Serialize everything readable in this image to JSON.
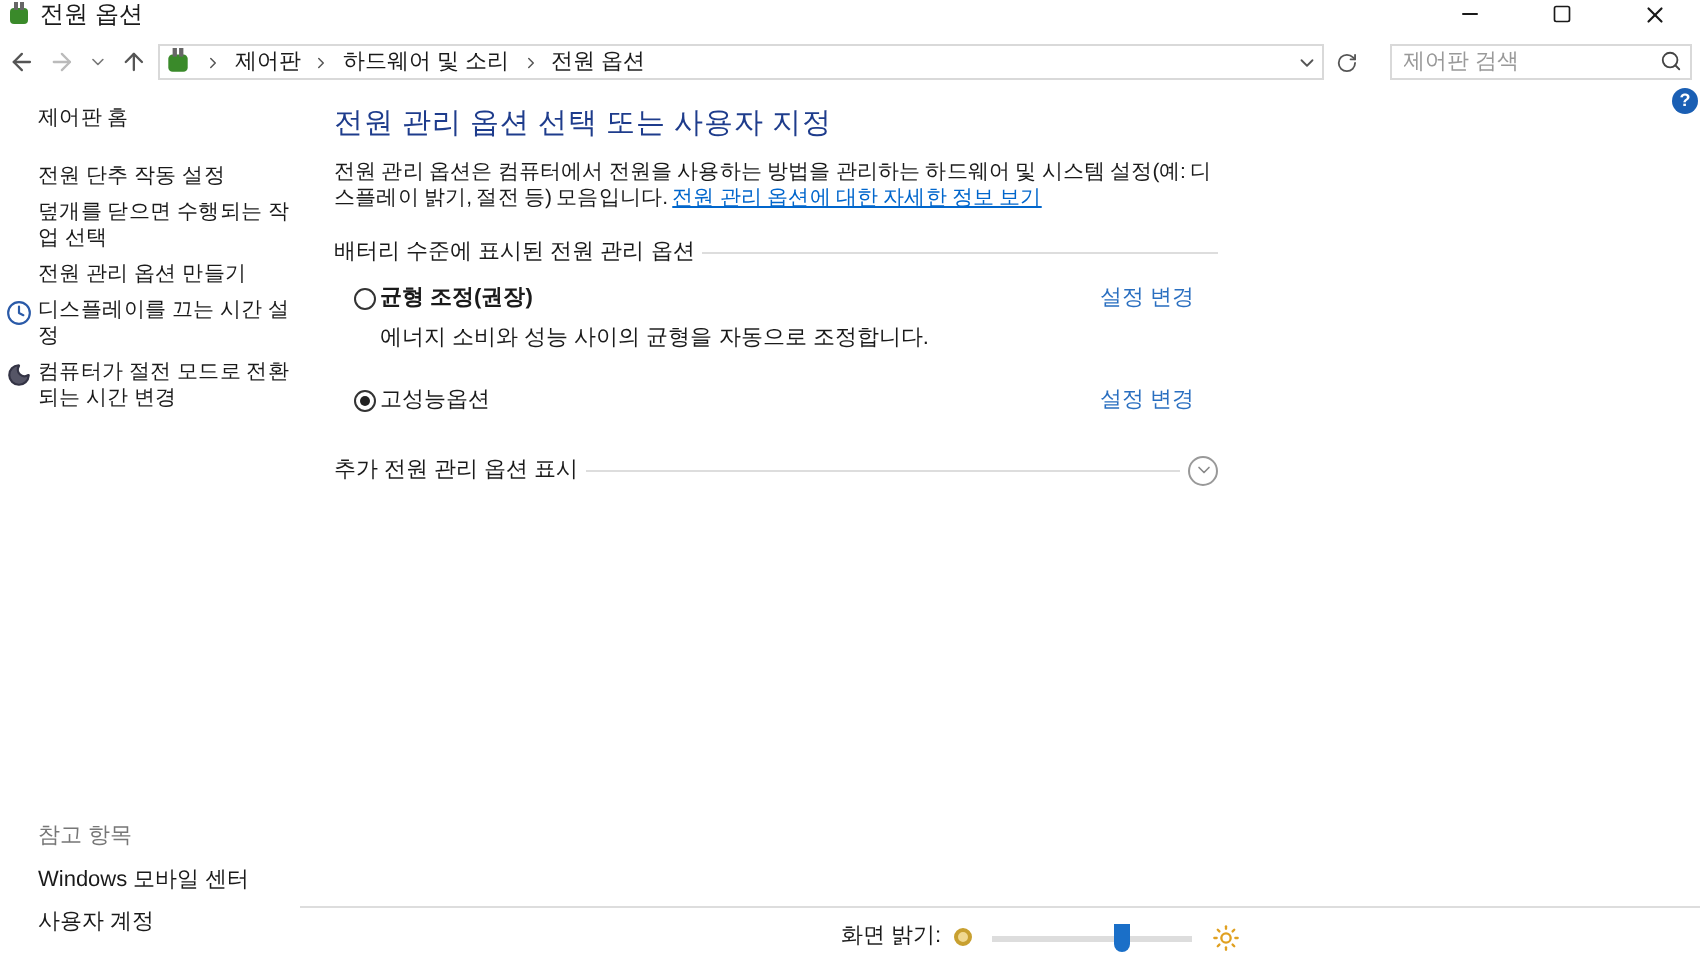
{
  "window": {
    "title": "전원 옵션"
  },
  "address_bar": {
    "breadcrumbs": [
      "제어판",
      "하드웨어 및 소리",
      "전원 옵션"
    ]
  },
  "search": {
    "placeholder": "제어판 검색"
  },
  "sidebar": {
    "items": [
      {
        "label": "제어판 홈",
        "kind": "home"
      },
      {
        "label": "전원 단추 작동 설정",
        "kind": "link"
      },
      {
        "label": "덮개를 닫으면 수행되는 작업 선택",
        "kind": "link"
      },
      {
        "label": "전원 관리 옵션 만들기",
        "kind": "link"
      },
      {
        "label": "디스플레이를 끄는 시간 설정",
        "kind": "display"
      },
      {
        "label": "컴퓨터가 절전 모드로 전환되는 시간 변경",
        "kind": "sleep"
      }
    ],
    "see_also": {
      "title": "참고 항목",
      "links": [
        "Windows 모바일 센터",
        "사용자 계정"
      ]
    }
  },
  "main": {
    "heading": "전원 관리 옵션 선택 또는 사용자 지정",
    "description": "전원 관리 옵션은 컴퓨터에서 전원을 사용하는 방법을 관리하는 하드웨어 및 시스템 설정(예: 디스플레이 밝기, 절전 등) 모음입니다.",
    "info_link": "전원 관리 옵션에 대한 자세한 정보 보기",
    "group_title": "배터리 수준에 표시된 전원 관리 옵션",
    "plans": [
      {
        "name": "균형 조정(권장)",
        "description": "에너지 소비와 성능 사이의 균형을 자동으로 조정합니다.",
        "selected": false,
        "action": "설정 변경"
      },
      {
        "name": "고성능옵션",
        "selected": true,
        "action": "설정 변경"
      }
    ],
    "more_plans": {
      "label": "추가 전원 관리 옵션 표시",
      "expanded": false
    }
  },
  "help": {
    "label": "?"
  },
  "brightness": {
    "label": "화면 밝기:",
    "level": 0.65
  }
}
